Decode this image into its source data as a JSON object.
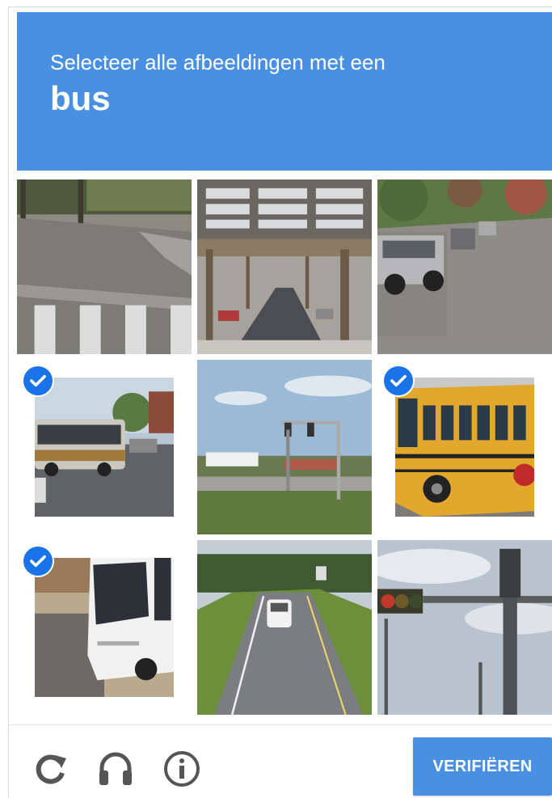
{
  "header": {
    "prompt": "Selecteer alle afbeeldingen met een",
    "target": "bus"
  },
  "tiles": [
    {
      "scene": "crosswalk-road",
      "selected": false
    },
    {
      "scene": "elevated-railway-street",
      "selected": false
    },
    {
      "scene": "suv-parked-street",
      "selected": false
    },
    {
      "scene": "articulated-bus",
      "selected": true
    },
    {
      "scene": "traffic-light-pole",
      "selected": false
    },
    {
      "scene": "yellow-school-bus",
      "selected": true
    },
    {
      "scene": "white-coach-bus",
      "selected": true
    },
    {
      "scene": "highway-white-car",
      "selected": false
    },
    {
      "scene": "traffic-light-sky",
      "selected": false
    }
  ],
  "footer": {
    "icons": [
      "reload-icon",
      "headphones-icon",
      "info-icon"
    ],
    "verify_label": "VERIFIËREN"
  },
  "colors": {
    "accent": "#4a90e2",
    "check": "#1a73e8",
    "icon": "#555555"
  }
}
